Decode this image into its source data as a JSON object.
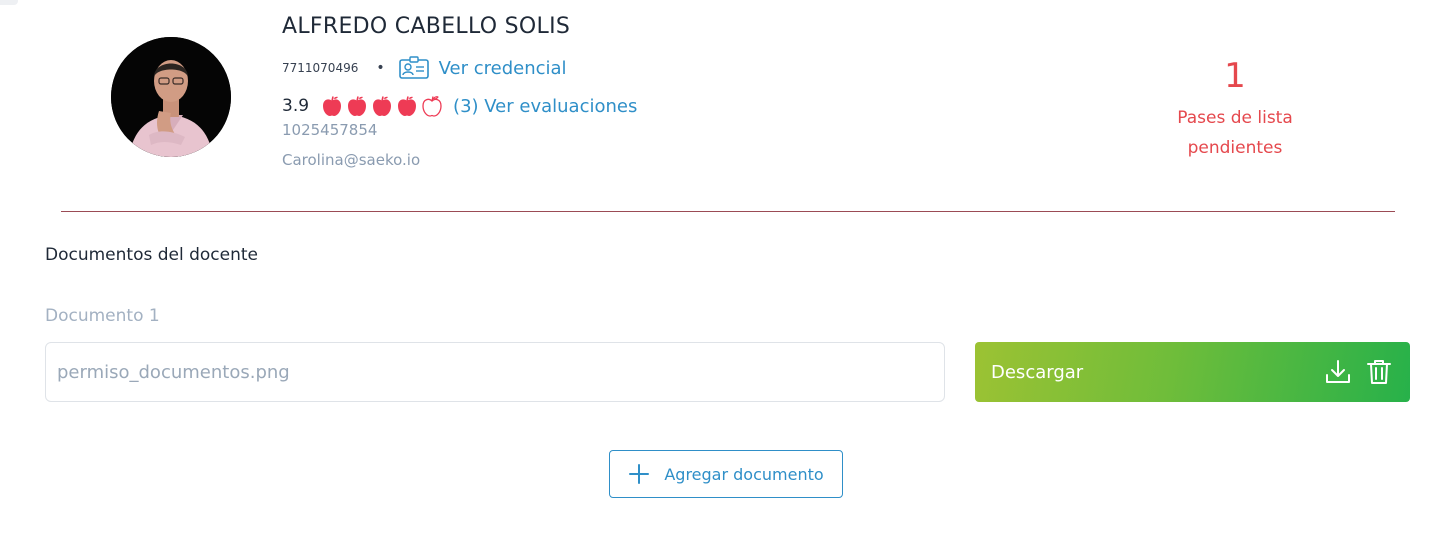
{
  "teacher": {
    "name": "ALFREDO CABELLO SOLIS",
    "id_number": "7711070496",
    "separator": "•",
    "credential_link": "Ver credencial",
    "rating": "3.9",
    "rating_apples": {
      "filled": 4,
      "total": 5
    },
    "evaluations_link": "(3) Ver evaluaciones",
    "phone": "1025457854",
    "email": "Carolina@saeko.io"
  },
  "pending": {
    "count": "1",
    "label_line1": "Pases de lista",
    "label_line2": "pendientes"
  },
  "documents": {
    "section_title": "Documentos del docente",
    "items": [
      {
        "label": "Documento 1",
        "filename": "permiso_documentos.png",
        "action_label": "Descargar"
      }
    ],
    "add_label": "Agregar documento"
  },
  "colors": {
    "link": "#2f8fc8",
    "pending": "#e5484d",
    "apple": "#ee3b55",
    "download_gradient_start": "#9cc233",
    "download_gradient_end": "#27b14a"
  },
  "icons": {
    "credential": "id-card-icon",
    "rating": "apple-icon",
    "download": "download-icon",
    "delete": "trash-icon",
    "add": "plus-icon"
  }
}
